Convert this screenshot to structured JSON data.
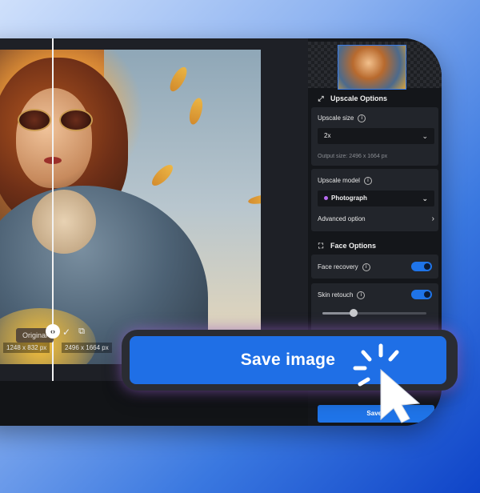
{
  "canvas": {
    "compare_original_label": "Original",
    "original_dims": "1248 x 832 px",
    "result_dims": "2496 x 1664 px"
  },
  "panel": {
    "upscale_options": {
      "title": "Upscale Options",
      "size_label": "Upscale size",
      "size_value": "2x",
      "output_hint": "Output size: 2496 x 1664 px",
      "model_label": "Upscale model",
      "model_value": "Photograph",
      "advanced_label": "Advanced option"
    },
    "face_options": {
      "title": "Face Options",
      "face_recovery_label": "Face recovery",
      "face_recovery_on": true,
      "skin_retouch_label": "Skin retouch",
      "skin_retouch_on": true,
      "skin_retouch_level": 0.3
    },
    "save_label": "Save i"
  },
  "cta": {
    "save_image_label": "Save image"
  },
  "colors": {
    "accent": "#1f6fe6",
    "panel_bg": "#14161a",
    "card_bg": "#22252b",
    "model_dot": "#b86cf1"
  },
  "icons": [
    "upscale-icon",
    "face-scan-icon",
    "info-icon",
    "chevron-down-icon",
    "chevron-right-icon",
    "check-icon",
    "compare-icon",
    "cursor-click-icon"
  ]
}
